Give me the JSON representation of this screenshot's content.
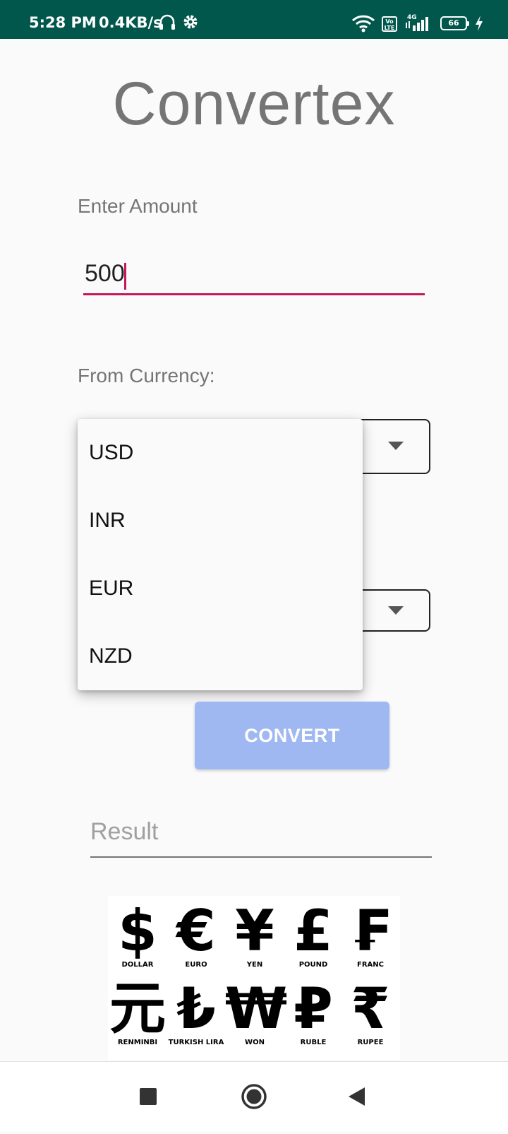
{
  "status_bar": {
    "time": "5:28 PM",
    "net_speed": "0.4KB/s",
    "volte_label": "Vo LTE",
    "network_type": "4G",
    "battery_level": "66",
    "icons": [
      "headphones-icon",
      "gear-icon",
      "wifi-icon",
      "volte-icon",
      "signal-icon",
      "battery-icon",
      "charging-icon"
    ]
  },
  "app": {
    "title": "Convertex",
    "amount_label": "Enter Amount",
    "amount_value": "500",
    "from_label": "From Currency:",
    "dropdown_options": [
      "USD",
      "INR",
      "EUR",
      "NZD"
    ],
    "convert_label": "CONVERT",
    "result_placeholder": "Result"
  },
  "currency_image": {
    "items": [
      {
        "symbol": "$",
        "name": "DOLLAR"
      },
      {
        "symbol": "€",
        "name": "EURO"
      },
      {
        "symbol": "¥",
        "name": "YEN"
      },
      {
        "symbol": "£",
        "name": "POUND"
      },
      {
        "symbol": "₣",
        "name": "FRANC"
      },
      {
        "symbol": "元",
        "name": "RENMINBI"
      },
      {
        "symbol": "₺",
        "name": "TURKISH LIRA"
      },
      {
        "symbol": "₩",
        "name": "WON"
      },
      {
        "symbol": "₽",
        "name": "RUBLE"
      },
      {
        "symbol": "₹",
        "name": "RUPEE"
      }
    ]
  },
  "colors": {
    "status_bar": "#01574c",
    "accent": "#c2185b",
    "button": "#a0b8f2"
  },
  "nav_bar": {
    "icons": [
      "recents-square-icon",
      "home-circle-icon",
      "back-triangle-icon"
    ]
  }
}
